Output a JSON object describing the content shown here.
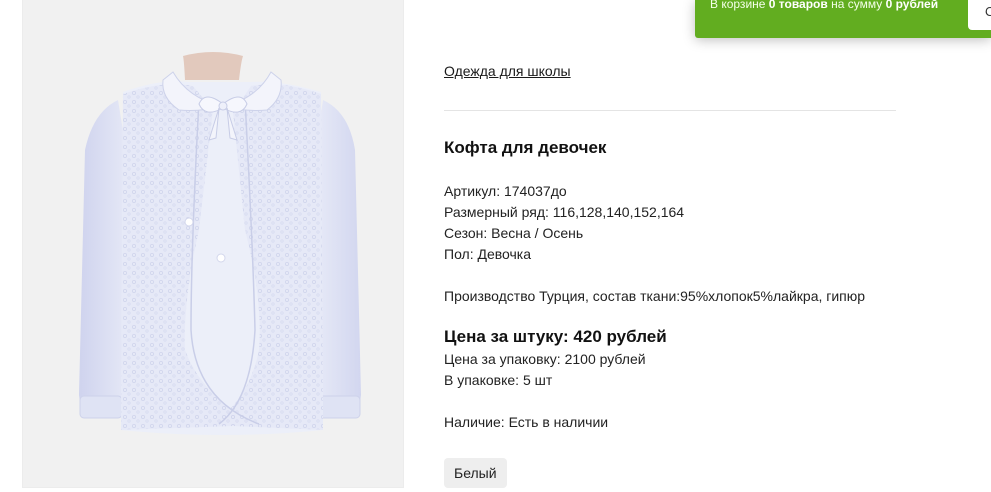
{
  "cart": {
    "prefix": "В корзине ",
    "count": "0 товаров",
    "middle": " на сумму ",
    "sum": "0 рублей",
    "button_label": "О"
  },
  "product": {
    "image_icon": "blouse-photo",
    "category": "Одежда для школы",
    "title": "Кофта для девочек",
    "article": "Артикул: 174037до",
    "sizes": "Размерный ряд: 116,128,140,152,164",
    "season": "Сезон: Весна / Осень",
    "gender": "Пол: Девочка",
    "production": "Производство Турция, состав ткани:95%хлопок5%лайкра, гипюр",
    "price_unit": "Цена за штуку: 420 рублей",
    "price_pack": "Цена за упаковку: 2100 рублей",
    "pack_qty": "В упаковке: 5 шт",
    "availability": "Наличие: Есть в наличии",
    "color_option": "Белый"
  },
  "colors": {
    "cart_bar": "#62ad20",
    "photo_background": "#f1f1f1",
    "garment": "#e4e8f6"
  }
}
